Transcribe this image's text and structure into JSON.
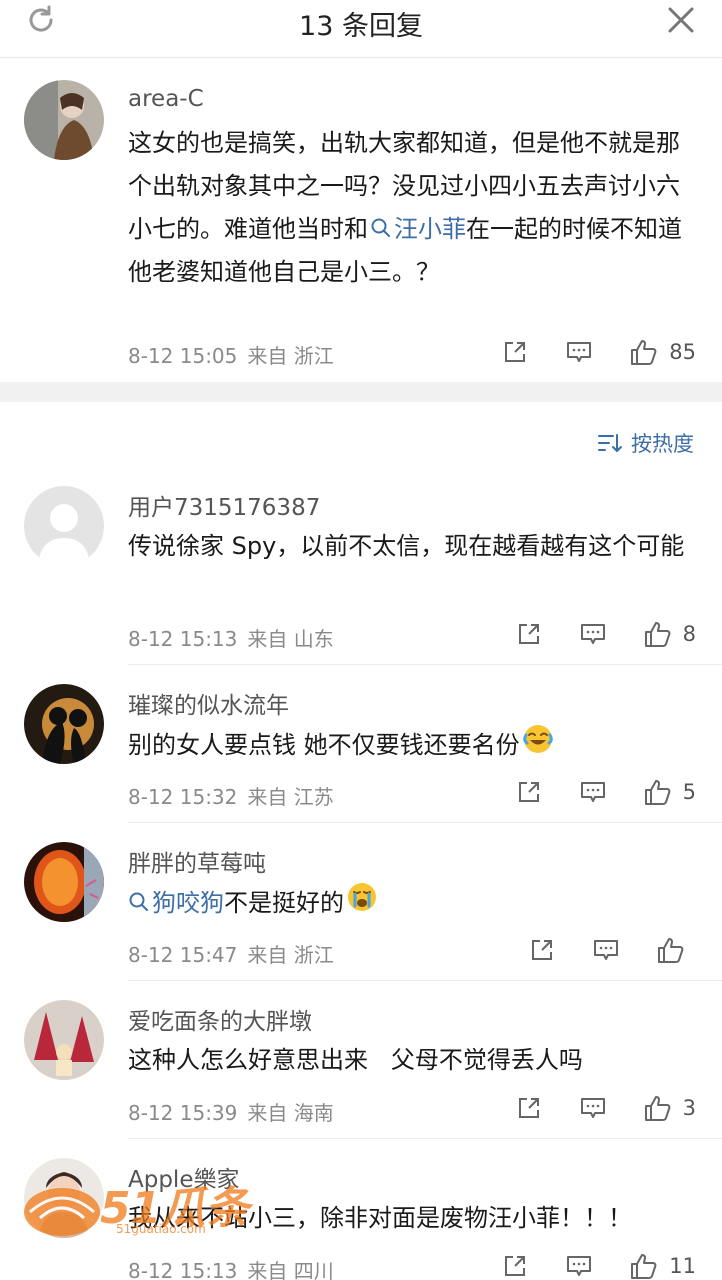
{
  "header": {
    "title": "13 条回复"
  },
  "main_comment": {
    "username": "area-C",
    "content_before": "这女的也是搞笑，出轨大家都知道，但是他不就是那个出轨对象其中之一吗？没见过小四小五去声讨小六小七的。难道他当时和",
    "topic": "汪小菲",
    "content_after": "在一起的时候不知道他老婆知道他自己是小三。？",
    "time": "8-12 15:05",
    "location": "来自 浙江",
    "likes": "85"
  },
  "sort": {
    "label": "按热度"
  },
  "replies": [
    {
      "username": "用户7315176387",
      "content": "传说徐家 Spy，以前不太信，现在越看越有这个可能",
      "time": "8-12 15:13",
      "location": "来自 山东",
      "likes": "8"
    },
    {
      "username": "璀璨的似水流年",
      "content": "别的女人要点钱 她不仅要钱还要名份",
      "emoji": "laugh-cry",
      "time": "8-12 15:32",
      "location": "来自 江苏",
      "likes": "5"
    },
    {
      "username": "胖胖的草莓吨",
      "topic": "狗咬狗",
      "content": "不是挺好的",
      "emoji": "crying",
      "time": "8-12 15:47",
      "location": "来自 浙江",
      "likes": ""
    },
    {
      "username": "爱吃面条的大胖墩",
      "content": "这种人怎么好意思出来   父母不觉得丢人吗",
      "time": "8-12 15:39",
      "location": "来自 海南",
      "likes": "3"
    },
    {
      "username": "Apple樂家",
      "content": "我从来不站小三，除非对面是废物汪小菲！！！",
      "time": "8-12 15:13",
      "location": "来自 四川",
      "likes": "11"
    }
  ],
  "watermark": {
    "big": "51瓜条",
    "small": "51guatiao.com"
  },
  "colors": {
    "link": "#3e6ea8",
    "meta": "#8a8a8a",
    "band": "#f1f1f1"
  }
}
